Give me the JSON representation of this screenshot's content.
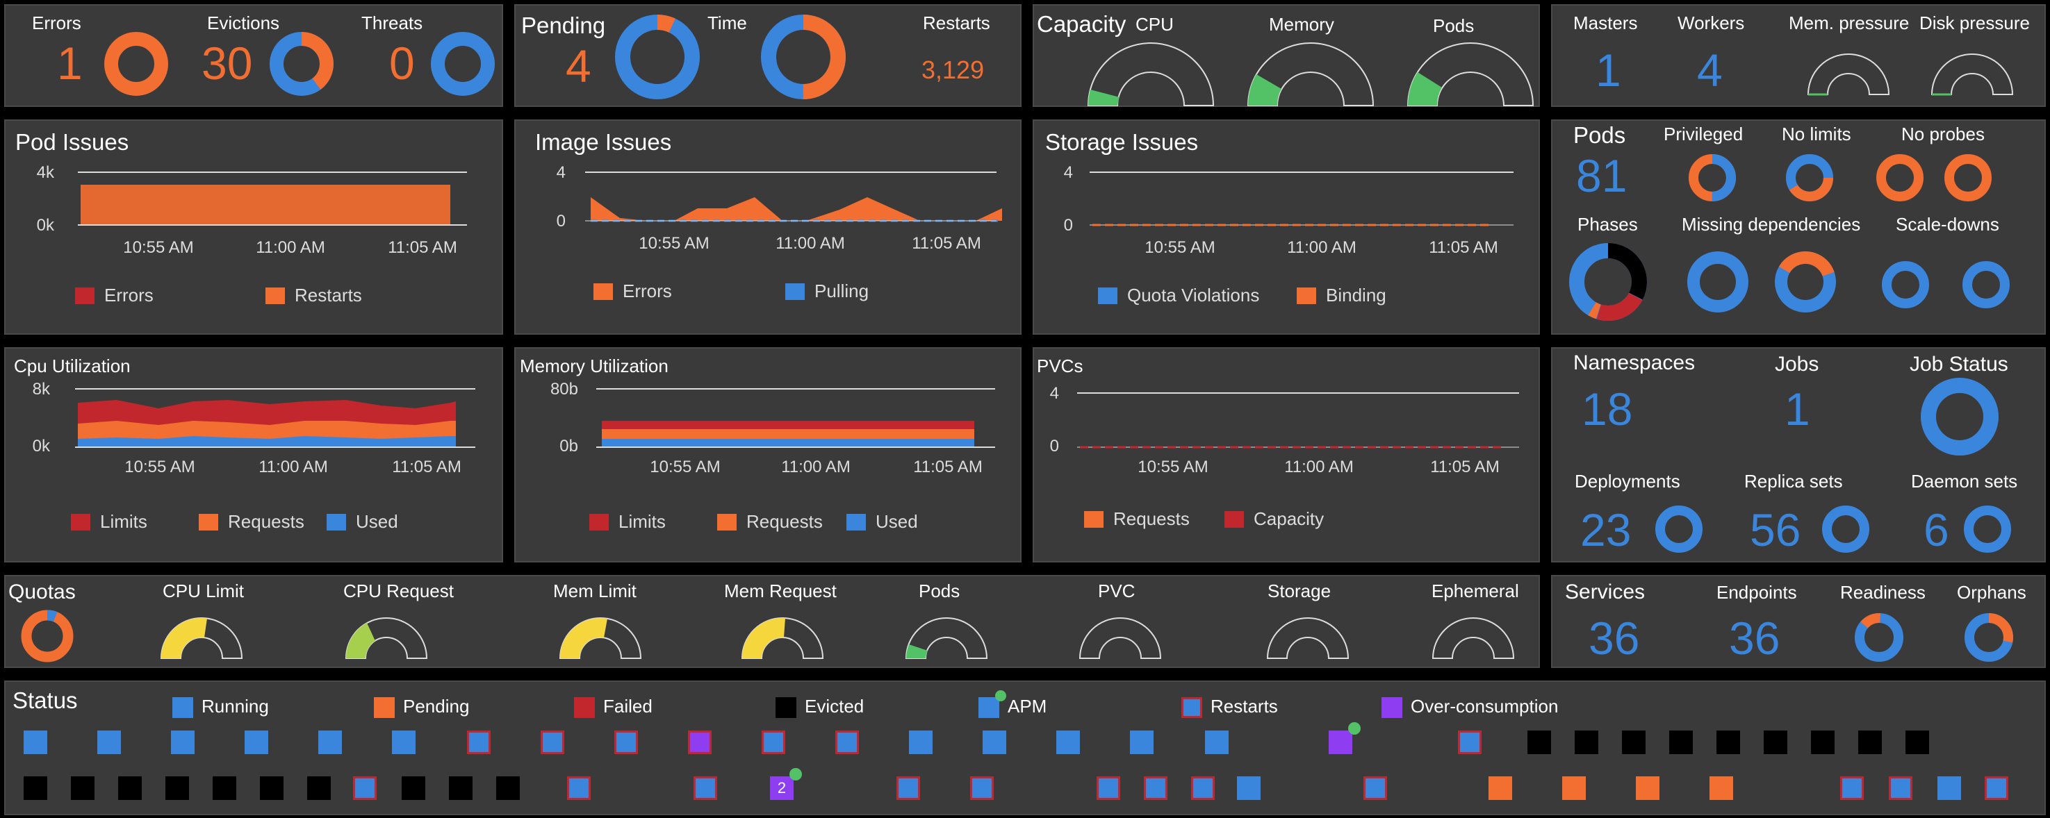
{
  "colors": {
    "orange": "#f26e31",
    "blue": "#3a86dd",
    "red": "#c1272d",
    "black": "#000000",
    "purple": "#8e3df0",
    "green": "#53c267",
    "yellow": "#f5d63d",
    "lime": "#a5cf4c"
  },
  "top": {
    "errors": {
      "label": "Errors",
      "value": "1"
    },
    "evictions": {
      "label": "Evictions",
      "value": "30"
    },
    "threats": {
      "label": "Threats",
      "value": "0"
    },
    "pending": {
      "label": "Pending",
      "value": "4"
    },
    "time": {
      "label": "Time"
    },
    "restarts": {
      "label": "Restarts",
      "value": "3,129"
    },
    "capacity": {
      "label": "Capacity",
      "cpu": "CPU",
      "memory": "Memory",
      "pods": "Pods"
    },
    "masters": {
      "label": "Masters",
      "value": "1"
    },
    "workers": {
      "label": "Workers",
      "value": "4"
    },
    "mem_pressure": "Mem. pressure",
    "disk_pressure": "Disk pressure"
  },
  "charts": {
    "pod_issues": {
      "title": "Pod Issues",
      "yticks": [
        "4k",
        "0k"
      ],
      "xticks": [
        "10:55 AM",
        "11:00 AM",
        "11:05 AM"
      ],
      "legend": [
        "Errors",
        "Restarts"
      ]
    },
    "image_issues": {
      "title": "Image Issues",
      "yticks": [
        "4",
        "0"
      ],
      "xticks": [
        "10:55 AM",
        "11:00 AM",
        "11:05 AM"
      ],
      "legend": [
        "Errors",
        "Pulling"
      ]
    },
    "storage_issues": {
      "title": "Storage Issues",
      "yticks": [
        "4",
        "0"
      ],
      "xticks": [
        "10:55 AM",
        "11:00 AM",
        "11:05 AM"
      ],
      "legend": [
        "Quota Violations",
        "Binding"
      ]
    },
    "cpu_util": {
      "title": "Cpu Utilization",
      "yticks": [
        "8k",
        "0k"
      ],
      "xticks": [
        "10:55 AM",
        "11:00 AM",
        "11:05 AM"
      ],
      "legend": [
        "Limits",
        "Requests",
        "Used"
      ]
    },
    "mem_util": {
      "title": "Memory Utilization",
      "yticks": [
        "80b",
        "0b"
      ],
      "xticks": [
        "10:55 AM",
        "11:00 AM",
        "11:05 AM"
      ],
      "legend": [
        "Limits",
        "Requests",
        "Used"
      ]
    },
    "pvcs": {
      "title": "PVCs",
      "yticks": [
        "4",
        "0"
      ],
      "xticks": [
        "10:55 AM",
        "11:00 AM",
        "11:05 AM"
      ],
      "legend": [
        "Requests",
        "Capacity"
      ]
    }
  },
  "pods_panel": {
    "title": "Pods",
    "value": "81",
    "privileged": "Privileged",
    "no_limits": "No limits",
    "no_probes": "No probes",
    "phases": "Phases",
    "missing_deps": "Missing dependencies",
    "scale_downs": "Scale-downs"
  },
  "ns_panel": {
    "namespaces": "Namespaces",
    "ns_value": "18",
    "jobs": "Jobs",
    "jobs_value": "1",
    "job_status": "Job Status",
    "deployments": "Deployments",
    "dep_value": "23",
    "replica_sets": "Replica sets",
    "rs_value": "56",
    "daemon_sets": "Daemon sets",
    "ds_value": "6"
  },
  "quotas": {
    "title": "Quotas",
    "cpu_limit": "CPU Limit",
    "cpu_request": "CPU Request",
    "mem_limit": "Mem Limit",
    "mem_request": "Mem Request",
    "pods": "Pods",
    "pvc": "PVC",
    "storage": "Storage",
    "ephemeral": "Ephemeral"
  },
  "services": {
    "title": "Services",
    "value": "36",
    "endpoints": "Endpoints",
    "ep_value": "36",
    "readiness": "Readiness",
    "orphans": "Orphans"
  },
  "status": {
    "title": "Status",
    "legend": [
      {
        "label": "Running",
        "kind": "running"
      },
      {
        "label": "Pending",
        "kind": "pending"
      },
      {
        "label": "Failed",
        "kind": "failed"
      },
      {
        "label": "Evicted",
        "kind": "evicted"
      },
      {
        "label": "APM",
        "kind": "apm"
      },
      {
        "label": "Restarts",
        "kind": "restarts"
      },
      {
        "label": "Over-consumption",
        "kind": "over"
      }
    ],
    "row1": [
      "running",
      "running",
      "running",
      "running",
      "running",
      "running",
      "restarts",
      "restarts",
      "restarts",
      "over-restart",
      "restarts",
      "restarts",
      "running",
      "running",
      "running",
      "running",
      "running",
      "over-apm",
      "restarts",
      "evicted",
      "evicted",
      "evicted",
      "evicted",
      "evicted",
      "evicted",
      "evicted",
      "evicted",
      "evicted"
    ],
    "row2": [
      "evicted",
      "evicted",
      "evicted",
      "evicted",
      "evicted",
      "evicted",
      "evicted",
      "restarts",
      "evicted",
      "evicted",
      "evicted",
      "restarts",
      "restarts",
      "over-apm-2",
      "restarts",
      "restarts",
      "restarts",
      "restarts",
      "restarts",
      "running",
      "restarts",
      "pending",
      "pending",
      "pending",
      "pending",
      "restarts",
      "restarts",
      "running",
      "restarts"
    ],
    "badge": "2"
  }
}
